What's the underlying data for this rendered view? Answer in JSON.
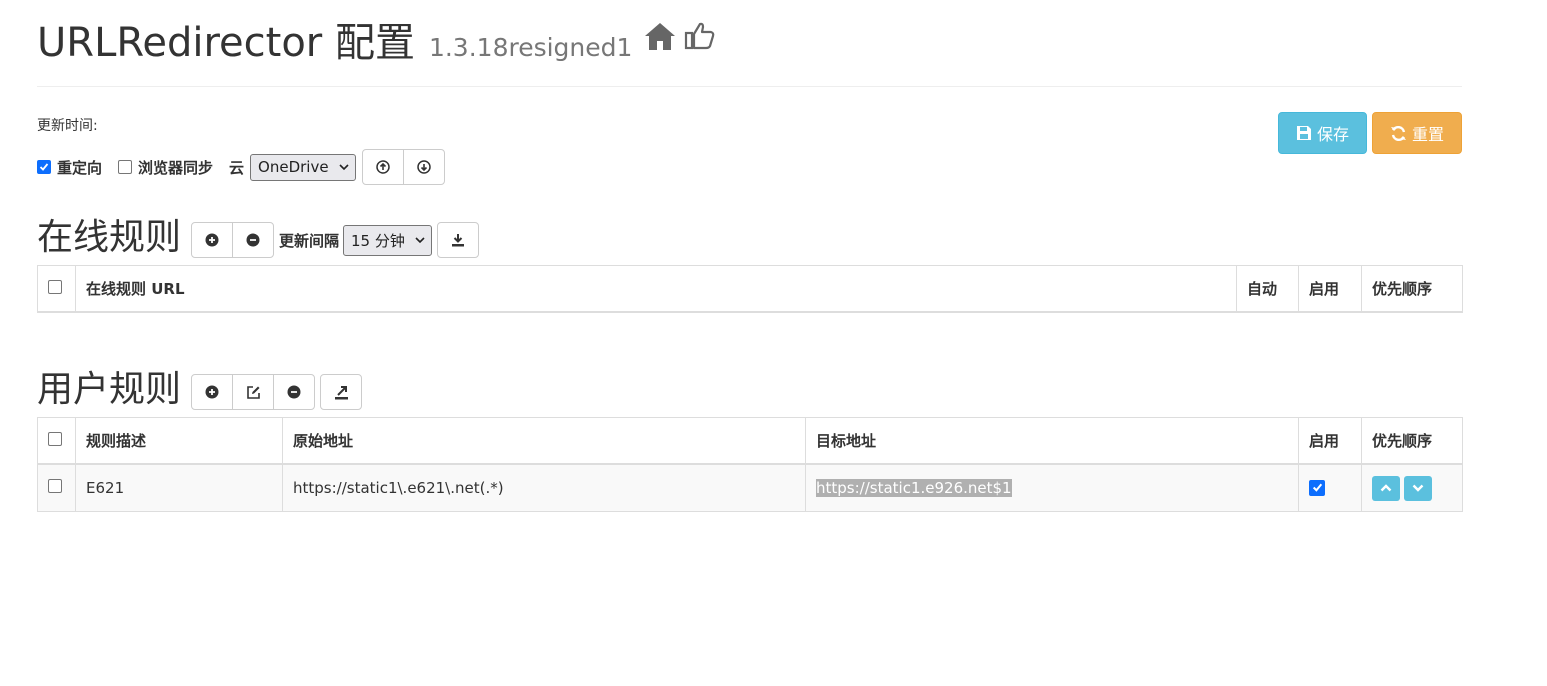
{
  "header": {
    "title": "URLRedirector 配置",
    "version": "1.3.18resigned1"
  },
  "update_time_label": "更新时间:",
  "actions": {
    "save_label": "保存",
    "reset_label": "重置"
  },
  "options": {
    "redirect_label": "重定向",
    "redirect_checked": true,
    "browser_sync_label": "浏览器同步",
    "browser_sync_checked": false,
    "cloud_label": "云",
    "cloud_selected": "OneDrive"
  },
  "online_rules": {
    "title": "在线规则",
    "interval_label": "更新间隔",
    "interval_selected": "15 分钟",
    "columns": {
      "url": "在线规则 URL",
      "auto": "自动",
      "enabled": "启用",
      "priority": "优先顺序"
    },
    "rows": []
  },
  "user_rules": {
    "title": "用户规则",
    "columns": {
      "description": "规则描述",
      "origin": "原始地址",
      "target": "目标地址",
      "enabled": "启用",
      "priority": "优先顺序"
    },
    "rows": [
      {
        "description": "E621",
        "origin": "https://static1\\.e621\\.net(.*)",
        "target": "https://static1.e926.net$1",
        "enabled": true
      }
    ]
  },
  "colors": {
    "info": "#5bc0de",
    "warning": "#f0ad4e",
    "checkbox": "#0d6efd"
  }
}
